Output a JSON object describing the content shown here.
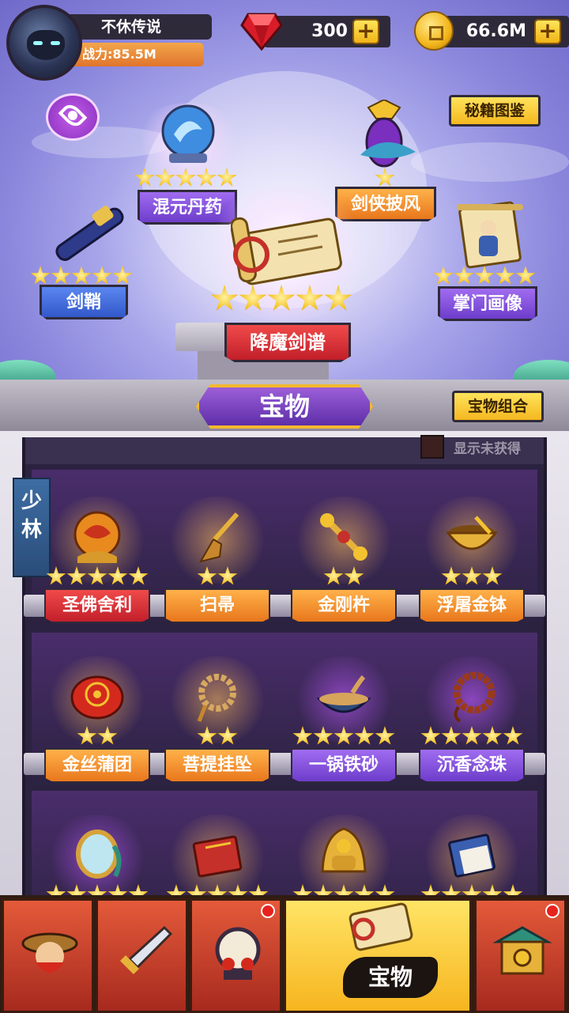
{
  "player": {
    "name": "不休传说",
    "power": "战力:85.5M"
  },
  "currency": {
    "gems": "300",
    "coins": "66.6M",
    "gem_icon": "ruby-gem-icon",
    "coin_icon": "gold-coin-icon",
    "plus": "+"
  },
  "top_buttons": {
    "catalog": "秘籍图鉴",
    "combo": "宝物组合"
  },
  "equipped": [
    {
      "name": "混元丹药",
      "stars": 5,
      "color": "purple"
    },
    {
      "name": "剑侠披风",
      "stars": 1,
      "color": "orange"
    },
    {
      "name": "剑鞘",
      "stars": 5,
      "color": "blue"
    },
    {
      "name": "降魔剑谱",
      "stars": 5,
      "color": "red"
    },
    {
      "name": "掌门画像",
      "stars": 5,
      "color": "purple"
    }
  ],
  "section_title": "宝物",
  "show_unowned": "显示未获得",
  "sect_tag": [
    "少",
    "林"
  ],
  "collection": [
    {
      "name": "圣佛舍利",
      "stars": 5,
      "color": "red"
    },
    {
      "name": "扫帚",
      "stars": 2,
      "color": "orange"
    },
    {
      "name": "金刚杵",
      "stars": 2,
      "color": "orange"
    },
    {
      "name": "浮屠金钵",
      "stars": 3,
      "color": "orange"
    },
    {
      "name": "金丝蒲团",
      "stars": 2,
      "color": "orange"
    },
    {
      "name": "菩提挂坠",
      "stars": 2,
      "color": "orange"
    },
    {
      "name": "一锅铁砂",
      "stars": 5,
      "color": "purple"
    },
    {
      "name": "沉香念珠",
      "stars": 5,
      "color": "purple"
    },
    {
      "name": "",
      "stars": 5,
      "color": "purple"
    },
    {
      "name": "",
      "stars": 5,
      "color": "purple"
    },
    {
      "name": "",
      "stars": 5,
      "color": "purple"
    },
    {
      "name": "",
      "stars": 5,
      "color": "blue"
    }
  ],
  "nav": {
    "active_label": "宝物",
    "items": [
      "hero-icon",
      "weapon-icon",
      "drum-icon",
      "treasure-icon",
      "shop-icon"
    ]
  },
  "colors": {
    "purple": "#6d3dcb",
    "orange": "#e8771c",
    "red": "#c21f2a",
    "blue": "#3258c9",
    "gold": "#f4b820"
  }
}
